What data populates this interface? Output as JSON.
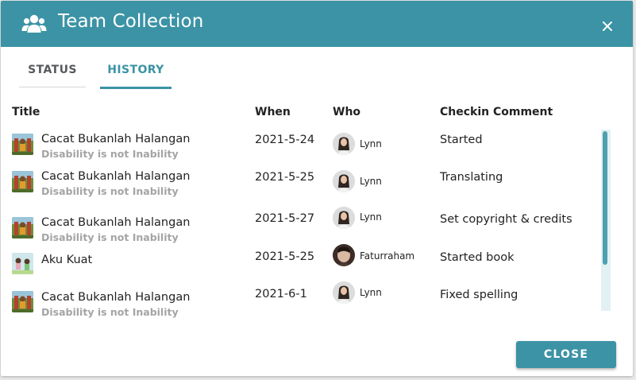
{
  "dialog": {
    "title": "Team Collection",
    "title_icon": "team-icon",
    "close_icon": "close-icon",
    "accent_color": "#3b93a5"
  },
  "tabs": [
    {
      "label": "STATUS",
      "selected": false
    },
    {
      "label": "HISTORY",
      "selected": true
    }
  ],
  "table": {
    "columns": [
      "Title",
      "When",
      "Who",
      "Checkin Comment"
    ],
    "rows": [
      {
        "title": "Cacat Bukanlah Halangan",
        "subtitle": "Disability is not Inability",
        "when": "2021-5-24",
        "who": "Lynn",
        "comment": "Started"
      },
      {
        "title": "Cacat Bukanlah Halangan",
        "subtitle": "Disability is not Inability",
        "when": "2021-5-25",
        "who": "Lynn",
        "comment": "Translating"
      },
      {
        "title": "Cacat Bukanlah Halangan",
        "subtitle": "Disability is not Inability",
        "when": "2021-5-27",
        "who": "Lynn",
        "comment": "Set copyright & credits"
      },
      {
        "title": "Aku Kuat",
        "subtitle": "",
        "when": "2021-5-25",
        "who": "Faturraham",
        "comment": "Started book"
      },
      {
        "title": "Cacat Bukanlah Halangan",
        "subtitle": "Disability is not Inability",
        "when": "2021-6-1",
        "who": "Lynn",
        "comment": "Fixed spelling"
      }
    ]
  },
  "footer": {
    "close_label": "CLOSE"
  }
}
